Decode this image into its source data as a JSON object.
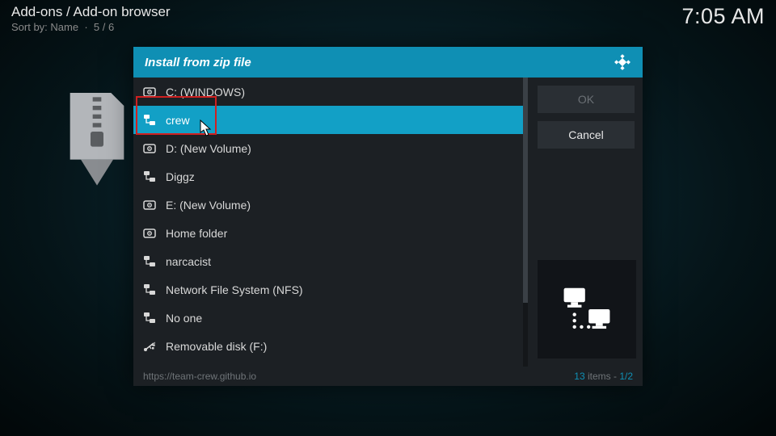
{
  "header": {
    "breadcrumb": "Add-ons / Add-on browser",
    "sort_label": "Sort by: Name",
    "sort_count": "5 / 6",
    "clock": "7:05 AM"
  },
  "dialog": {
    "title": "Install from zip file",
    "buttons": {
      "ok": "OK",
      "cancel": "Cancel"
    },
    "items": [
      {
        "label": "C: (WINDOWS)",
        "icon": "drive"
      },
      {
        "label": "crew",
        "icon": "network",
        "selected": true
      },
      {
        "label": "D: (New Volume)",
        "icon": "drive"
      },
      {
        "label": "Diggz",
        "icon": "network"
      },
      {
        "label": "E: (New Volume)",
        "icon": "drive"
      },
      {
        "label": "Home folder",
        "icon": "drive"
      },
      {
        "label": "narcacist",
        "icon": "network"
      },
      {
        "label": "Network File System (NFS)",
        "icon": "network"
      },
      {
        "label": "No one",
        "icon": "network"
      },
      {
        "label": "Removable disk (F:)",
        "icon": "usb"
      }
    ],
    "footer": {
      "path": "https://team-crew.github.io",
      "count": "13",
      "count_suffix": " items - ",
      "page": "1/2"
    }
  }
}
